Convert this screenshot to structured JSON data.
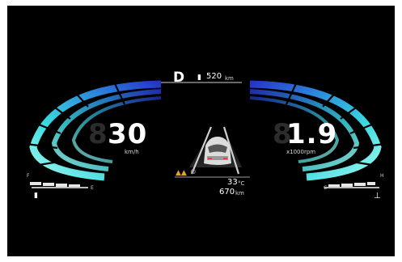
{
  "top_bar": {
    "gear": "D",
    "fuel_icon": "fuel-pump-icon",
    "range_value": "520",
    "range_unit": "km"
  },
  "speedometer": {
    "value": "30",
    "ghost_digit": "8",
    "unit": "km/h"
  },
  "tachometer": {
    "value": "1.9",
    "ghost_digit": "8",
    "unit": "x1000rpm"
  },
  "fuel_gauge": {
    "full_label": "F",
    "empty_label": "E",
    "icon": "fuel-pump-icon",
    "level": 0.75
  },
  "temp_gauge": {
    "cold_label": "C",
    "hot_label": "H",
    "icon": "coolant-temperature-icon",
    "level": 0.5
  },
  "center": {
    "outside_temp": "33",
    "temp_unit": "°C",
    "odometer": "670",
    "odometer_unit": "km",
    "warning_icons": [
      "lane-keep-warning-icon",
      "steering-assist-icon"
    ]
  },
  "colors": {
    "accent_blue": "#2a3fd6",
    "accent_cyan": "#5ff0e6",
    "background": "#000000"
  }
}
